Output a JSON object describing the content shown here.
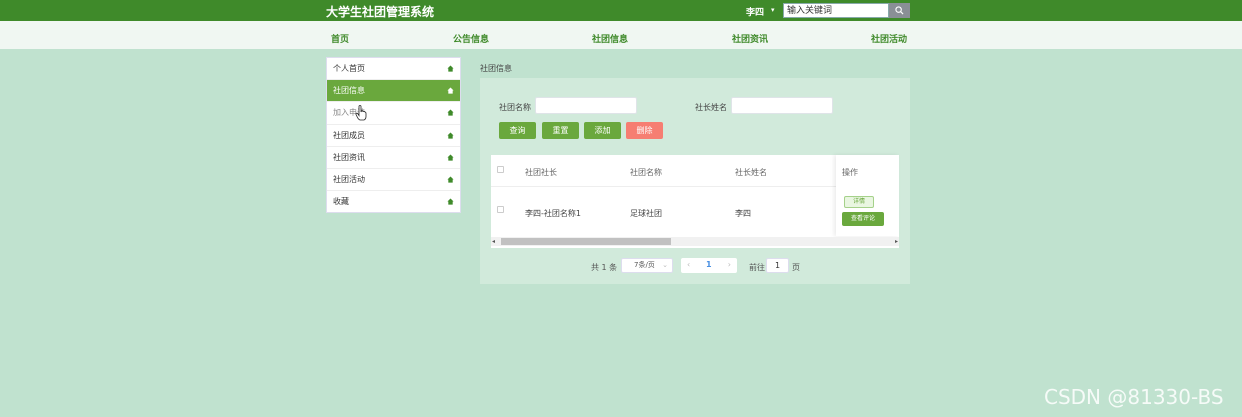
{
  "header": {
    "title": "大学生社团管理系统",
    "user": "李四",
    "search_placeholder": "输入关键词"
  },
  "nav": [
    "首页",
    "公告信息",
    "社团信息",
    "社团资讯",
    "社团活动"
  ],
  "sidebar": {
    "items": [
      {
        "label": "个人首页"
      },
      {
        "label": "社团信息"
      },
      {
        "label": "加入申请"
      },
      {
        "label": "社团成员"
      },
      {
        "label": "社团资讯"
      },
      {
        "label": "社团活动"
      },
      {
        "label": "收藏"
      }
    ]
  },
  "breadcrumb": "社团信息",
  "filters": {
    "club_name_label": "社团名称",
    "president_label": "社长姓名"
  },
  "buttons": {
    "query": "查询",
    "reset": "重置",
    "add": "添加",
    "delete": "删除"
  },
  "table": {
    "columns": [
      "社团社长",
      "社团名称",
      "社长姓名",
      "操作"
    ],
    "rows": [
      {
        "president_account": "李四-社团名称1",
        "club_name": "足球社团",
        "president_name": "李四"
      }
    ],
    "detail_label": "详情",
    "comment_label": "查看评论"
  },
  "pagination": {
    "total": "共 1 条",
    "page_size": "7条/页",
    "current_page": "1",
    "goto_label": "前往",
    "goto_value": "1",
    "page_suffix": "页"
  },
  "watermark": "CSDN @81330-BS",
  "colors": {
    "primary": "#3f8a2a",
    "accent": "#6aa83d",
    "danger": "#f67e72",
    "background": "#c0e2cf"
  }
}
